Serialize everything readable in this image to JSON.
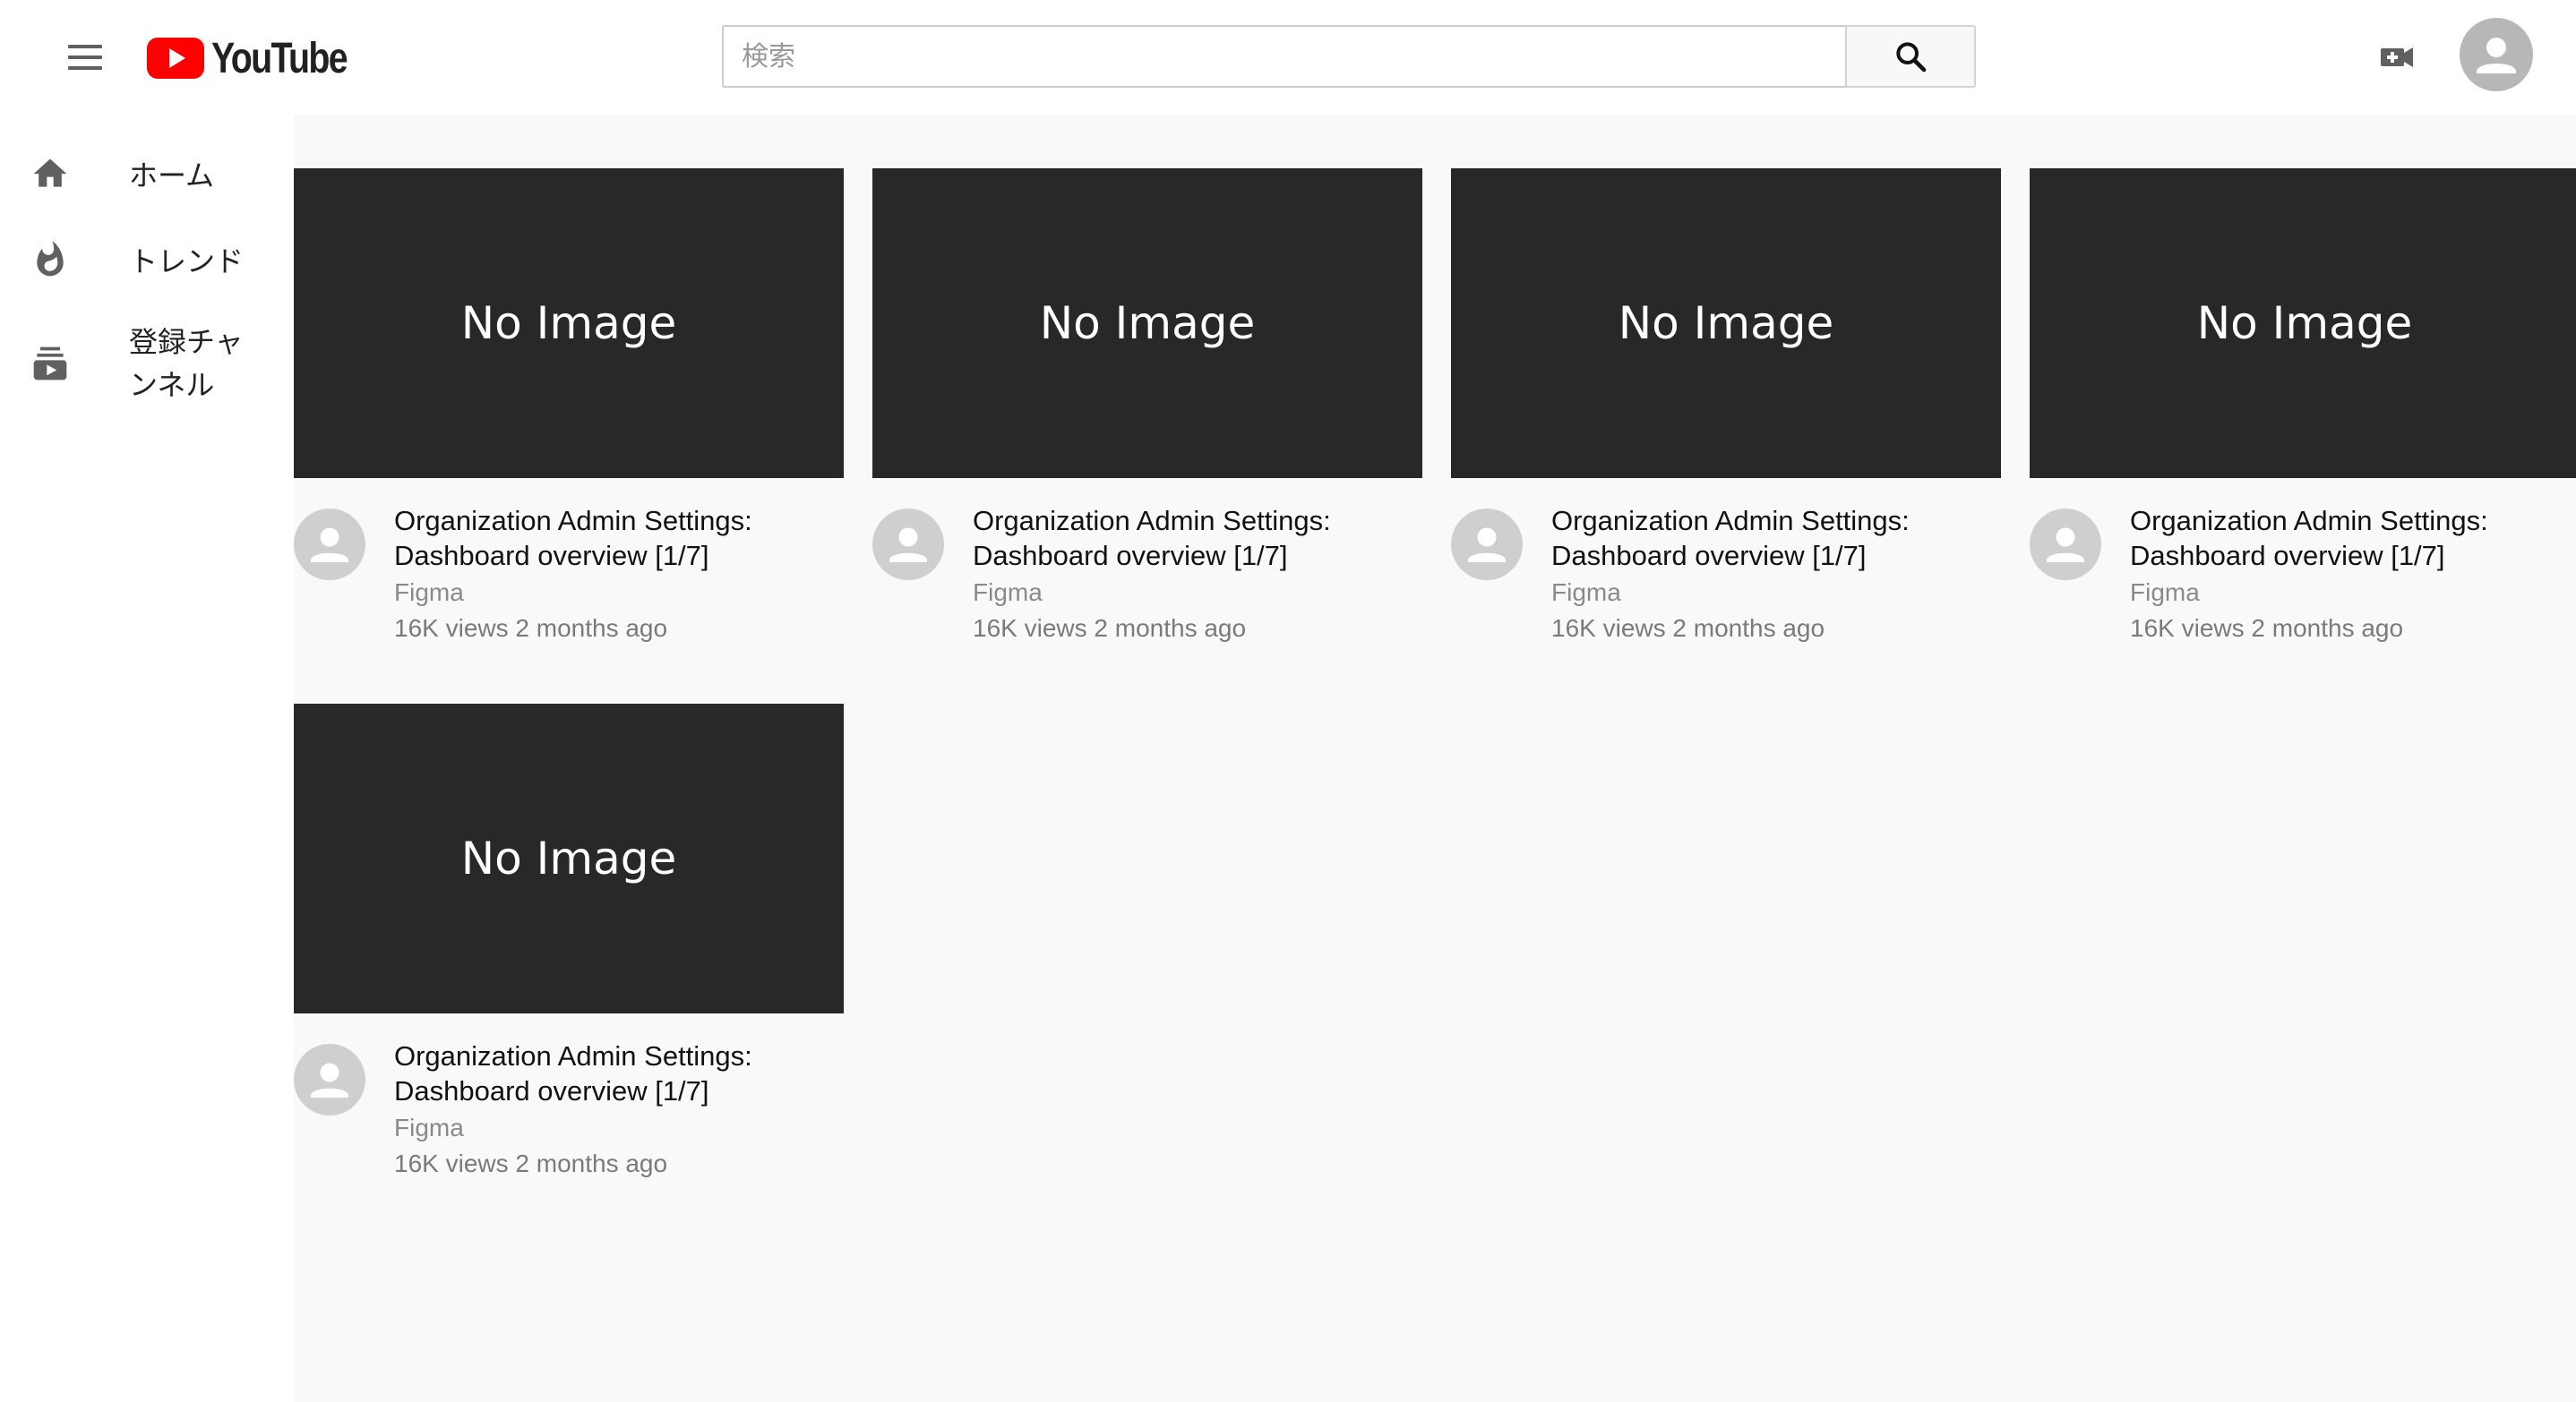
{
  "header": {
    "logo_text": "YouTube",
    "search_placeholder": "検索",
    "brand_color": "#ff0000"
  },
  "sidebar": {
    "items": [
      {
        "icon": "home-icon",
        "label": "ホーム"
      },
      {
        "icon": "trending-icon",
        "label": "トレンド"
      },
      {
        "icon": "subscriptions-icon",
        "label": "登録チャンネル"
      }
    ]
  },
  "videos": [
    {
      "thumbnail": "No Image",
      "title": "Organization Admin Settings: Dashboard overview [1/7]",
      "channel": "Figma",
      "stats": "16K views 2 months ago"
    },
    {
      "thumbnail": "No Image",
      "title": "Organization Admin Settings: Dashboard overview [1/7]",
      "channel": "Figma",
      "stats": "16K views 2 months ago"
    },
    {
      "thumbnail": "No Image",
      "title": "Organization Admin Settings: Dashboard overview [1/7]",
      "channel": "Figma",
      "stats": "16K views 2 months ago"
    },
    {
      "thumbnail": "No Image",
      "title": "Organization Admin Settings: Dashboard overview [1/7]",
      "channel": "Figma",
      "stats": "16K views 2 months ago"
    },
    {
      "thumbnail": "No Image",
      "title": "Organization Admin Settings: Dashboard overview [1/7]",
      "channel": "Figma",
      "stats": "16K views 2 months ago"
    }
  ]
}
